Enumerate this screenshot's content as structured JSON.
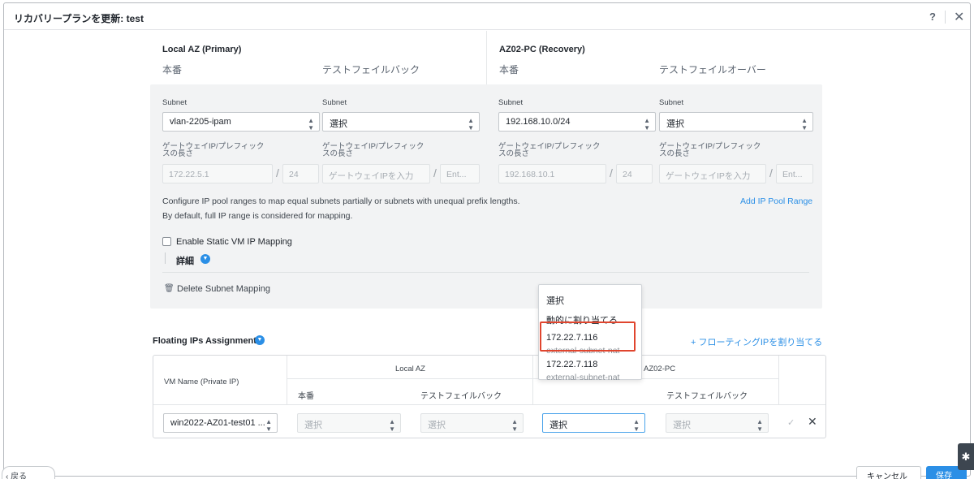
{
  "window": {
    "title": "リカバリープランを更新: test",
    "help": "?",
    "close": "✕"
  },
  "header": {
    "left": {
      "title": "Local AZ (Primary)",
      "col1": "本番",
      "col2": "テストフェイルバック"
    },
    "right": {
      "title": "AZ02-PC (Recovery)",
      "col1": "本番",
      "col2": "テストフェイルオーバー"
    }
  },
  "subnet_label": "Subnet",
  "gateway_label_line1": "ゲートウェイIP/プレフィック",
  "gateway_label_line2": "スの長さ",
  "subnets": [
    {
      "value": "vlan-2205-ipam",
      "gateway": "172.22.5.1",
      "prefix": "24"
    },
    {
      "value": "選択",
      "gateway_placeholder": "ゲートウェイIPを入力",
      "prefix_placeholder": "Ent..."
    },
    {
      "value": "192.168.10.0/24",
      "gateway": "192.168.10.1",
      "prefix": "24"
    },
    {
      "value": "選択",
      "gateway_placeholder": "ゲートウェイIPを入力",
      "prefix_placeholder": "Ent..."
    }
  ],
  "pool_info": {
    "line1": "Configure IP pool ranges to map equal subnets partially or subnets with unequal prefix lengths.",
    "line2": "By default, full IP range is considered for mapping.",
    "add_link": "Add IP Pool Range"
  },
  "static_mapping_label": "Enable Static VM IP Mapping",
  "detail_label": "詳細",
  "delete_label": "Delete Subnet Mapping",
  "floating": {
    "title": "Floating IPs Assignment",
    "assign_link": "+ フローティングIPを割り当てる",
    "headers": {
      "vm_name": "VM Name (Private IP)",
      "local_az": "Local AZ",
      "remote_az": "AZ02-PC",
      "col1": "本番",
      "col2": "テストフェイルバック",
      "col4": "テストフェイルバック"
    },
    "row": {
      "vm": "win2022-AZ01-test01 ...",
      "cell1": "選択",
      "cell2": "選択",
      "cell3": "選択",
      "cell4": "選択"
    }
  },
  "dropdown": {
    "items": [
      {
        "label": "選択"
      },
      {
        "label": "動的に割り当てる"
      },
      {
        "label": "172.22.7.116",
        "sub": "external-subnet-nat"
      },
      {
        "label": "172.22.7.118",
        "sub": "external-subnet-nat"
      }
    ]
  },
  "footer": {
    "back": "‹ 戻る",
    "cancel": "キャンセル",
    "save": "保存"
  },
  "side_tab": "✱"
}
